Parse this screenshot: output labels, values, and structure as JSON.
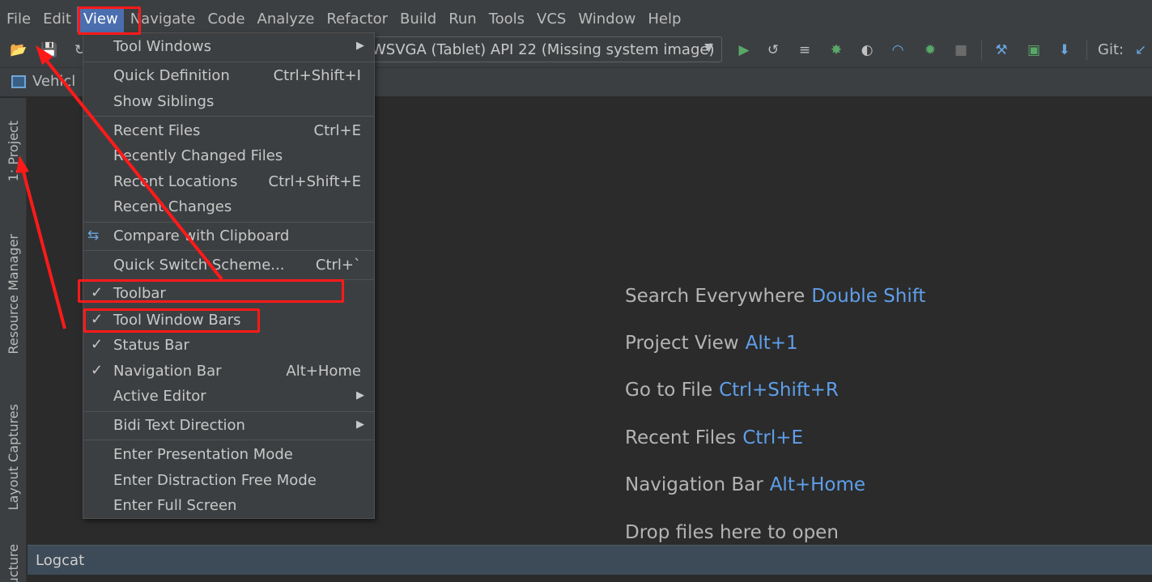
{
  "menubar": {
    "items": [
      "File",
      "Edit",
      "View",
      "Navigate",
      "Code",
      "Analyze",
      "Refactor",
      "Build",
      "Run",
      "Tools",
      "VCS",
      "Window",
      "Help"
    ],
    "active": "View"
  },
  "toolbar": {
    "device": "WSVGA (Tablet) API 22 (Missing system image)",
    "git_label": "Git:"
  },
  "navbar": {
    "crumb": "Vehicl"
  },
  "leftbar": {
    "project": "1: Project",
    "resource_manager": "Resource Manager",
    "layout_captures": "Layout Captures",
    "structure": "ucture"
  },
  "view_menu": {
    "items": [
      {
        "label": "Tool Windows",
        "shortcut": "",
        "submenu": true
      },
      {
        "label": "Quick Definition",
        "shortcut": "Ctrl+Shift+I"
      },
      {
        "label": "Show Siblings",
        "shortcut": ""
      },
      {
        "label": "Recent Files",
        "shortcut": "Ctrl+E"
      },
      {
        "label": "Recently Changed Files",
        "shortcut": ""
      },
      {
        "label": "Recent Locations",
        "shortcut": "Ctrl+Shift+E"
      },
      {
        "label": "Recent Changes",
        "shortcut": ""
      },
      {
        "label": "Compare with Clipboard",
        "shortcut": ""
      },
      {
        "label": "Quick Switch Scheme...",
        "shortcut": "Ctrl+`"
      },
      {
        "label": "Toolbar",
        "shortcut": "",
        "checked": true
      },
      {
        "label": "Tool Window Bars",
        "shortcut": "",
        "checked": true
      },
      {
        "label": "Status Bar",
        "shortcut": "",
        "checked": true
      },
      {
        "label": "Navigation Bar",
        "shortcut": "Alt+Home",
        "checked": true
      },
      {
        "label": "Active Editor",
        "shortcut": "",
        "submenu": true
      },
      {
        "label": "Bidi Text Direction",
        "shortcut": "",
        "submenu": true
      },
      {
        "label": "Enter Presentation Mode",
        "shortcut": ""
      },
      {
        "label": "Enter Distraction Free Mode",
        "shortcut": ""
      },
      {
        "label": "Enter Full Screen",
        "shortcut": ""
      }
    ]
  },
  "editor_hints": [
    {
      "label": "Search Everywhere",
      "key": "Double Shift"
    },
    {
      "label": "Project View",
      "key": "Alt+1"
    },
    {
      "label": "Go to File",
      "key": "Ctrl+Shift+R"
    },
    {
      "label": "Recent Files",
      "key": "Ctrl+E"
    },
    {
      "label": "Navigation Bar",
      "key": "Alt+Home"
    },
    {
      "label": "Drop files here to open",
      "key": ""
    }
  ],
  "bottom": {
    "logcat": "Logcat"
  },
  "colors": {
    "background": "#2b2b2b",
    "panel": "#3c3f41",
    "accent": "#4b6eaf",
    "shortcut_blue": "#5f9fea",
    "annotation_red": "#ff1a1a"
  }
}
